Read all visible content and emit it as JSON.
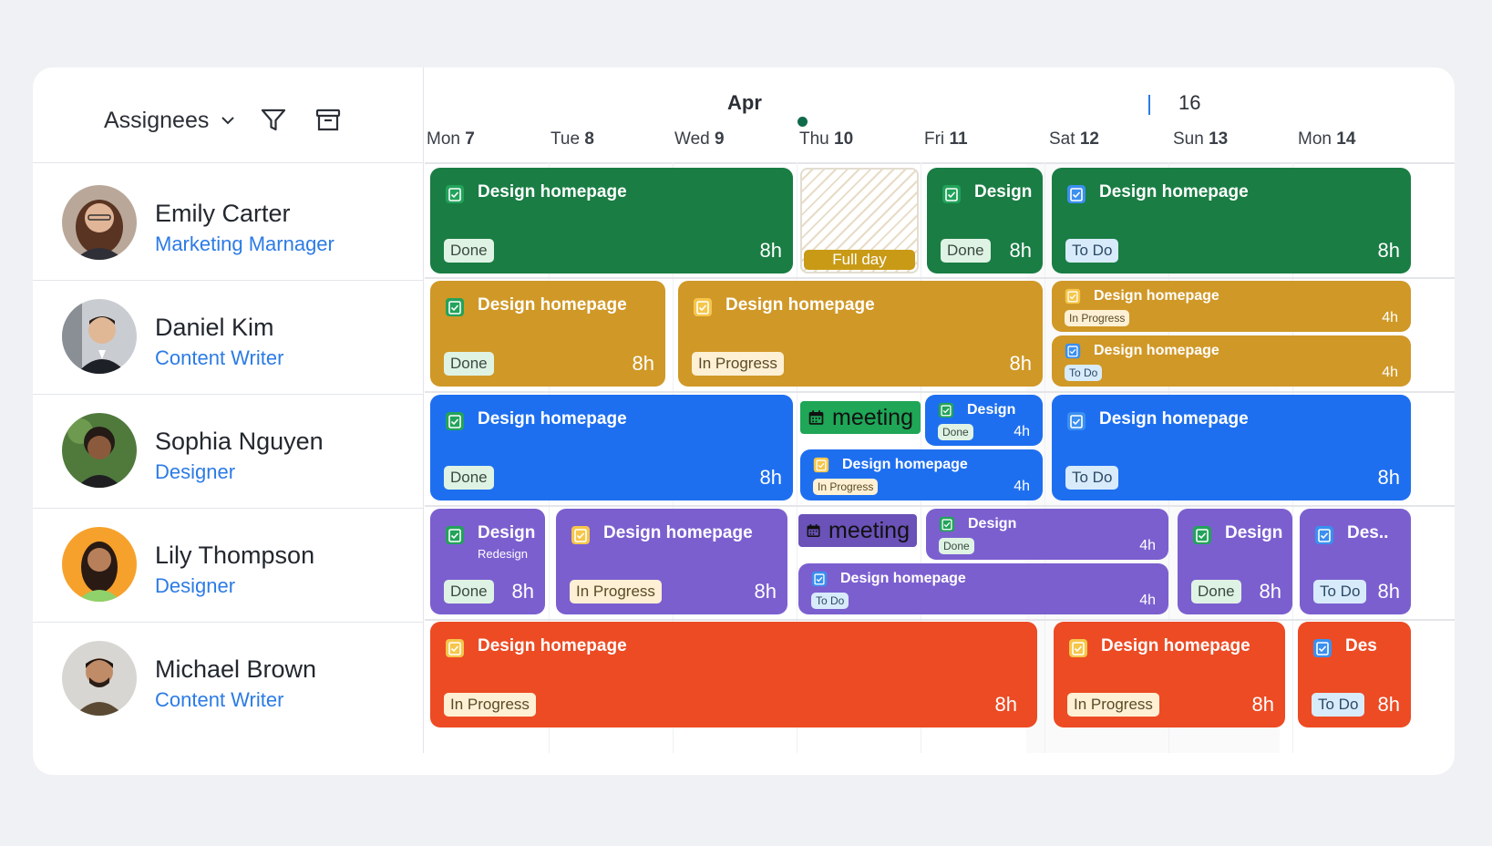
{
  "toolbar": {
    "group_by_label": "Assignees"
  },
  "colors": {
    "green": "#1a7d44",
    "gold": "#d09827",
    "blue": "#1e6ff0",
    "purple": "#7b5fcf",
    "red": "#ec4b24",
    "role": "#2c7be5"
  },
  "calendar": {
    "month": "Apr",
    "week_number": "16",
    "days": [
      {
        "dow": "Mon",
        "num": "7"
      },
      {
        "dow": "Tue",
        "num": "8"
      },
      {
        "dow": "Wed",
        "num": "9"
      },
      {
        "dow": "Thu",
        "num": "10"
      },
      {
        "dow": "Fri",
        "num": "11"
      },
      {
        "dow": "Sat",
        "num": "12"
      },
      {
        "dow": "Sun",
        "num": "13"
      },
      {
        "dow": "Mon",
        "num": "14"
      }
    ],
    "today": "Thu 10"
  },
  "people": [
    {
      "name": "Emily Carter",
      "role": "Marketing Marnager"
    },
    {
      "name": "Daniel Kim",
      "role": "Content Writer"
    },
    {
      "name": "Sophia Nguyen",
      "role": "Designer"
    },
    {
      "name": "Lily Thompson",
      "role": "Designer"
    },
    {
      "name": "Michael Brown",
      "role": "Content Writer"
    }
  ],
  "tasks": {
    "r1": [
      {
        "title": "Design homepage",
        "status": "Done",
        "hours": "8h"
      },
      {
        "title": "Design",
        "status": "Done",
        "hours": "8h"
      },
      {
        "title": "Design homepage",
        "status": "To Do",
        "hours": "8h"
      }
    ],
    "r1_fullday": "Full day",
    "r2": [
      {
        "title": "Design homepage",
        "status": "Done",
        "hours": "8h"
      },
      {
        "title": "Design homepage",
        "status": "In Progress",
        "hours": "8h"
      },
      {
        "title": "Design homepage",
        "status": "In Progress",
        "hours": "4h"
      },
      {
        "title": "Design homepage",
        "status": "To Do",
        "hours": "4h"
      }
    ],
    "r3": [
      {
        "title": "Design homepage",
        "status": "Done",
        "hours": "8h"
      },
      {
        "title": "Design",
        "status": "Done",
        "hours": "4h"
      },
      {
        "title": "Design homepage",
        "status": "In Progress",
        "hours": "4h"
      },
      {
        "title": "Design homepage",
        "status": "To Do",
        "hours": "8h"
      }
    ],
    "r3_meeting": "meeting",
    "r4": [
      {
        "title": "Design",
        "subtitle": "Redesign",
        "status": "Done",
        "hours": "8h"
      },
      {
        "title": "Design homepage",
        "status": "In Progress",
        "hours": "8h"
      },
      {
        "title": "Design",
        "status": "Done",
        "hours": "4h"
      },
      {
        "title": "Design homepage",
        "status": "To Do",
        "hours": "4h"
      },
      {
        "title": "Design",
        "status": "Done",
        "hours": "8h"
      },
      {
        "title": "Des..",
        "status": "To Do",
        "hours": "8h"
      }
    ],
    "r4_meeting": "meeting",
    "r5": [
      {
        "title": "Design homepage",
        "status": "In Progress",
        "hours": "8h"
      },
      {
        "title": "Design homepage",
        "status": "In Progress",
        "hours": "8h"
      },
      {
        "title": "Des",
        "status": "To Do",
        "hours": "8h"
      }
    ]
  }
}
